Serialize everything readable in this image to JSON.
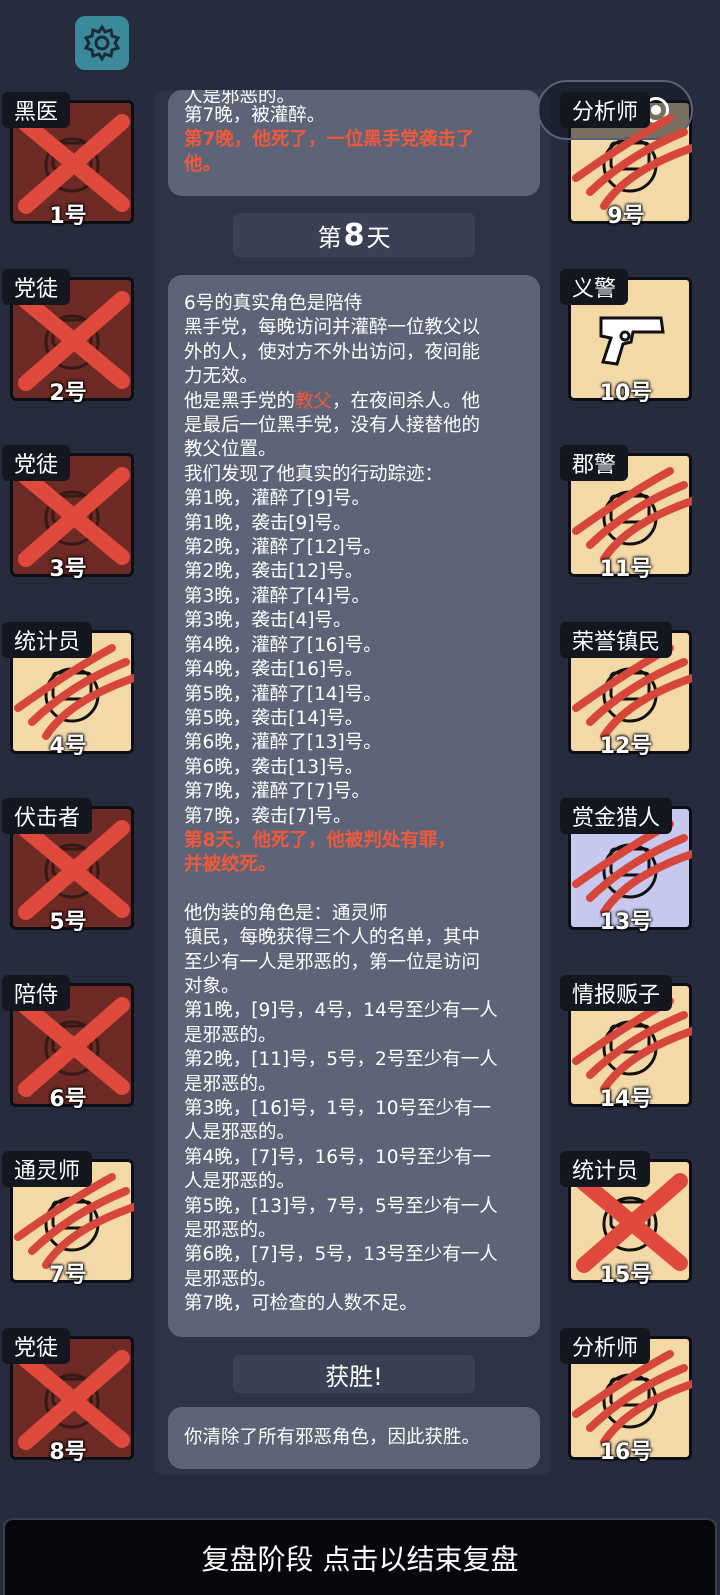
{
  "settings_icon": "gear-icon",
  "capsule": {
    "dots": "•••",
    "overlay_text": "分析师"
  },
  "players_left": [
    {
      "role": "黑医",
      "num": "1号",
      "dead": true,
      "mark": "x"
    },
    {
      "role": "党徒",
      "num": "2号",
      "dead": true,
      "mark": "x"
    },
    {
      "role": "党徒",
      "num": "3号",
      "dead": true,
      "mark": "x"
    },
    {
      "role": "统计员",
      "num": "4号",
      "dead": false,
      "mark": "claw"
    },
    {
      "role": "伏击者",
      "num": "5号",
      "dead": true,
      "mark": "x"
    },
    {
      "role": "陪侍",
      "num": "6号",
      "dead": true,
      "mark": "x"
    },
    {
      "role": "通灵师",
      "num": "7号",
      "dead": false,
      "mark": "claw"
    },
    {
      "role": "党徒",
      "num": "8号",
      "dead": true,
      "mark": "x"
    }
  ],
  "players_right": [
    {
      "role": "分析师",
      "num": "9号",
      "dead": false,
      "mark": "claw"
    },
    {
      "role": "义警",
      "num": "10号",
      "dead": false,
      "mark": "none"
    },
    {
      "role": "郡警",
      "num": "11号",
      "dead": false,
      "mark": "claw"
    },
    {
      "role": "荣誉镇民",
      "num": "12号",
      "dead": false,
      "mark": "claw"
    },
    {
      "role": "赏金猎人",
      "num": "13号",
      "dead": false,
      "mark": "claw"
    },
    {
      "role": "情报贩子",
      "num": "14号",
      "dead": false,
      "mark": "claw"
    },
    {
      "role": "统计员",
      "num": "15号",
      "dead": false,
      "mark": "x"
    },
    {
      "role": "分析师",
      "num": "16号",
      "dead": false,
      "mark": "claw"
    }
  ],
  "log": {
    "top_box": {
      "partial": "人是邪恶的。",
      "line": "第7晚，被灌醉。",
      "death_1": "第7晚，他死了，一位黑手党袭击了",
      "death_2": "他。"
    },
    "day_header": {
      "prefix": "第",
      "number": "8",
      "suffix": "天"
    },
    "main_box": {
      "l1": "6号的真实角色是陪侍",
      "l2": "黑手党，每晚访问并灌醉一位教父以",
      "l3": "外的人，使对方不外出访问，夜间能",
      "l4": "力无效。",
      "l5a": "他是黑手党的",
      "l5b": "教父",
      "l5c": "，在夜间杀人。他",
      "l6": "是最后一位黑手党，没有人接替他的",
      "l7": "教父位置。",
      "l8": "我们发现了他真实的行动踪迹：",
      "actions": [
        "第1晚，灌醉了[9]号。",
        "第1晚，袭击[9]号。",
        "第2晚，灌醉了[12]号。",
        "第2晚，袭击[12]号。",
        "第3晚，灌醉了[4]号。",
        "第3晚，袭击[4]号。",
        "第4晚，灌醉了[16]号。",
        "第4晚，袭击[16]号。",
        "第5晚，灌醉了[14]号。",
        "第5晚，袭击[14]号。",
        "第6晚，灌醉了[13]号。",
        "第6晚，袭击[13]号。",
        "第7晚，灌醉了[7]号。",
        "第7晚，袭击[7]号。"
      ],
      "verdict_1": "第8天，他死了，他被判处有罪，",
      "verdict_2": "并被绞死。",
      "fake": [
        "他伪装的角色是：通灵师",
        "镇民，每晚获得三个人的名单，其中",
        "至少有一人是邪恶的，第一位是访问",
        "对象。",
        "第1晚，[9]号，4号，14号至少有一人",
        "是邪恶的。",
        "第2晚，[11]号，5号，2号至少有一人",
        "是邪恶的。",
        "第3晚，[16]号，1号，10号至少有一",
        "人是邪恶的。",
        "第4晚，[7]号，16号，10号至少有一",
        "人是邪恶的。",
        "第5晚，[13]号，7号，5号至少有一人",
        "是邪恶的。",
        "第6晚，[7]号，5号，13号至少有一人",
        "是邪恶的。",
        "第7晚，可检查的人数不足。"
      ]
    },
    "victory_header": "获胜!",
    "victory_text": "你清除了所有邪恶角色，因此获胜。"
  },
  "footer_text": "复盘阶段 点击以结束复盘"
}
